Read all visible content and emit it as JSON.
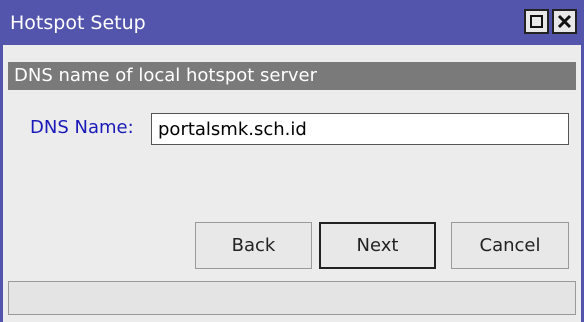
{
  "window": {
    "title": "Hotspot Setup",
    "maximize_icon": "maximize-icon",
    "close_icon": "close-icon"
  },
  "section": {
    "header": "DNS name of local hotspot server"
  },
  "dns": {
    "label": "DNS Name:",
    "value": "portalsmk.sch.id"
  },
  "buttons": {
    "back": "Back",
    "next": "Next",
    "cancel": "Cancel"
  },
  "status": {
    "text": ""
  },
  "colors": {
    "titlebar": "#5355ad",
    "section_header": "#7a7a7a",
    "label": "#1a1ab8"
  }
}
